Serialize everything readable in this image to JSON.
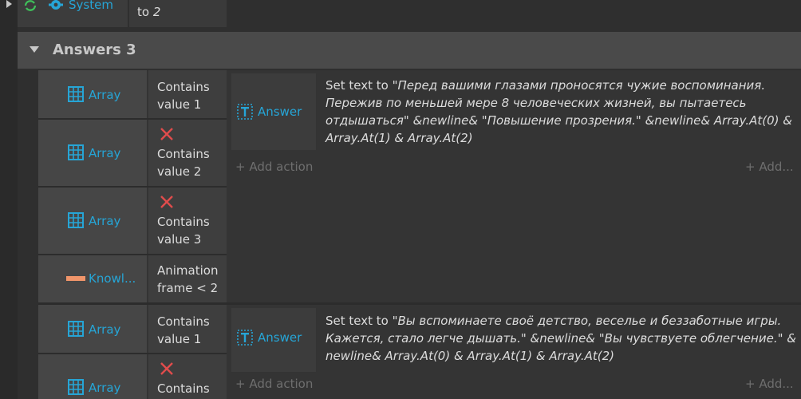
{
  "top_row": {
    "object_label": "System",
    "param_prefix": "to",
    "param_value": "2"
  },
  "group": {
    "title": "Answers 3"
  },
  "event1": {
    "conditions": [
      {
        "object": "Array",
        "text_line1": "Contains",
        "text_line2": "value 1",
        "inverted": false
      },
      {
        "object": "Array",
        "text_line1": "Contains",
        "text_line2": "value 2",
        "inverted": true
      },
      {
        "object": "Array",
        "text_line1": "Contains",
        "text_line2": "value 3",
        "inverted": true
      },
      {
        "object": "Knowl...",
        "text_line1": "Animation",
        "text_line2": "frame < 2",
        "inverted": false
      }
    ],
    "action_object": "Answer",
    "action_lines": [
      {
        "plain": "Set text to ",
        "italic": "\"Перед вашими глазами проносятся чужие воспоминания."
      },
      {
        "plain": "",
        "italic": "Пережив по меньшей мере 8 человеческих жизней, вы пытаетесь"
      },
      {
        "plain": "",
        "italic": "отдышаться\" &newline& \"Повышение прозрения.\" &newline& Array.At(0) &"
      },
      {
        "plain": "",
        "italic": "Array.At(1) & Array.At(2)"
      }
    ],
    "add_action": "Add action",
    "add_more": "Add..."
  },
  "event2": {
    "conditions": [
      {
        "object": "Array",
        "text_line1": "Contains",
        "text_line2": "value 1",
        "inverted": false
      },
      {
        "object": "Array",
        "text_line1": "Contains",
        "text_line2": "",
        "inverted": true
      }
    ],
    "action_object": "Answer",
    "action_lines": [
      {
        "plain": "Set text to ",
        "italic": "\"Вы вспоминаете своё детство, веселье и беззаботные игры."
      },
      {
        "plain": "",
        "italic": "Кажется, стало легче дышать.\" &newline& \"Вы чувствуете облегчение.\" &"
      },
      {
        "plain": "",
        "italic": "newline& Array.At(0) & Array.At(1) & Array.At(2)"
      }
    ],
    "add_action": "Add action",
    "add_more": "Add..."
  },
  "colors": {
    "object_blue": "#26a5d6",
    "invert_red": "#e04c4c",
    "knowledge_orange": "#f0956a"
  },
  "icons": {
    "system": "refresh-icon",
    "gear": "gear-icon",
    "array": "grid-icon",
    "text": "text-object-icon",
    "sprite": "sprite-bar-icon",
    "invert": "x-icon"
  }
}
